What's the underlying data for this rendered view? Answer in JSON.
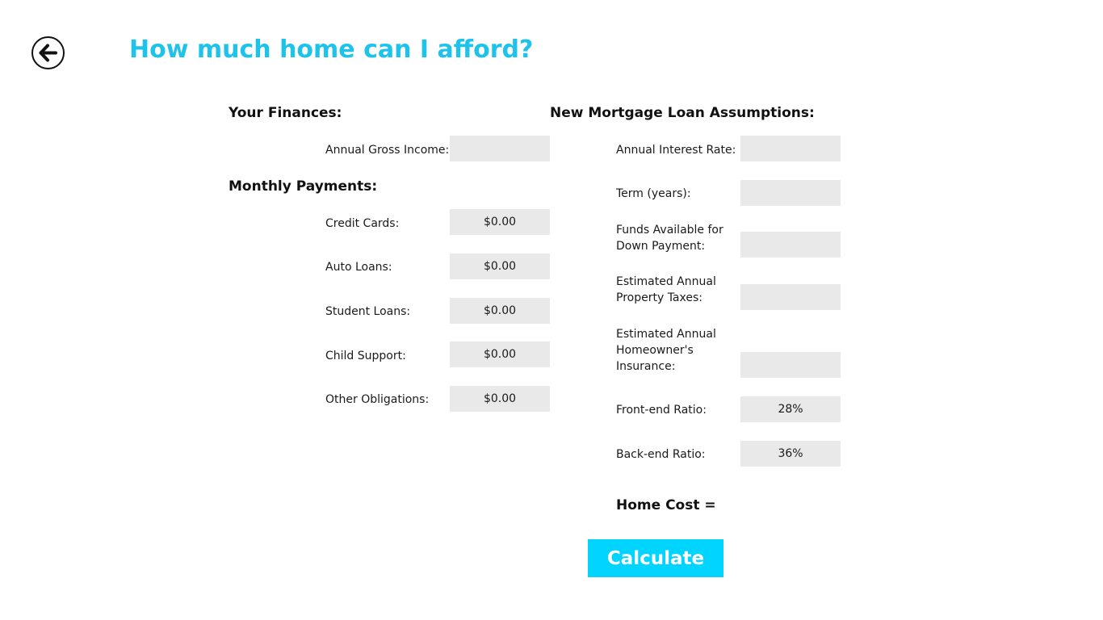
{
  "header": {
    "title": "How much home can I afford?",
    "back_icon": "back-arrow-icon"
  },
  "finances": {
    "heading": "Your Finances:",
    "annual_gross_income": {
      "label": "Annual Gross Income:",
      "value": ""
    }
  },
  "monthly_payments": {
    "heading": "Monthly Payments:",
    "credit_cards": {
      "label": "Credit Cards:",
      "value": "$0.00"
    },
    "auto_loans": {
      "label": "Auto Loans:",
      "value": "$0.00"
    },
    "student_loans": {
      "label": "Student Loans:",
      "value": "$0.00"
    },
    "child_support": {
      "label": "Child Support:",
      "value": "$0.00"
    },
    "other_obligations": {
      "label": "Other Obligations:",
      "value": "$0.00"
    }
  },
  "assumptions": {
    "heading": "New Mortgage Loan Assumptions:",
    "annual_interest_rate": {
      "label": "Annual Interest Rate:",
      "value": ""
    },
    "term_years": {
      "label": "Term (years):",
      "value": ""
    },
    "down_payment": {
      "label_line1": "Funds Available for",
      "label_line2": "Down Payment:",
      "value": ""
    },
    "property_taxes": {
      "label_line1": "Estimated Annual",
      "label_line2": "Property Taxes:",
      "value": ""
    },
    "homeowners_insurance": {
      "label_line1": "Estimated Annual",
      "label_line2": "Homeowner's",
      "label_line3": "Insurance:",
      "value": ""
    },
    "front_end_ratio": {
      "label": "Front-end Ratio:",
      "value": "28%"
    },
    "back_end_ratio": {
      "label": "Back-end Ratio:",
      "value": "36%"
    }
  },
  "result": {
    "home_cost_label": "Home Cost ="
  },
  "actions": {
    "calculate_label": "Calculate"
  },
  "colors": {
    "accent": "#1ec3ec",
    "button": "#00d4ff",
    "input_background": "#e9e9e9"
  }
}
